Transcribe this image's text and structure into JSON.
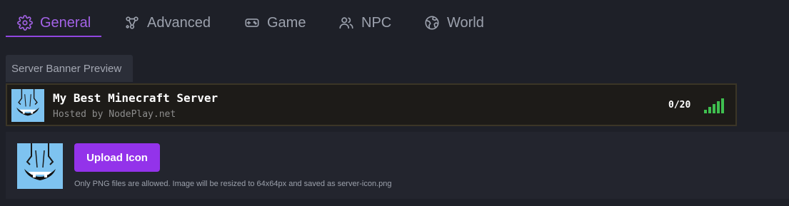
{
  "tabs": [
    {
      "label": "General",
      "icon": "gear-icon",
      "active": true
    },
    {
      "label": "Advanced",
      "icon": "nodes-icon",
      "active": false
    },
    {
      "label": "Game",
      "icon": "gamepad-icon",
      "active": false
    },
    {
      "label": "NPC",
      "icon": "users-icon",
      "active": false
    },
    {
      "label": "World",
      "icon": "globe-icon",
      "active": false
    }
  ],
  "preview": {
    "label": "Server Banner Preview",
    "server_name": "My Best Minecraft Server",
    "motd": "Hosted by NodePlay.net",
    "player_count": "0/20",
    "signal_icon": "signal-bars-icon"
  },
  "upload": {
    "button_label": "Upload Icon",
    "hint": "Only PNG files are allowed. Image will be resized to 64x64px and saved as server-icon.png"
  },
  "colors": {
    "accent": "#9333ea",
    "active_tab": "#a463e7",
    "background": "#1e2028",
    "signal": "#3fbf4f"
  }
}
